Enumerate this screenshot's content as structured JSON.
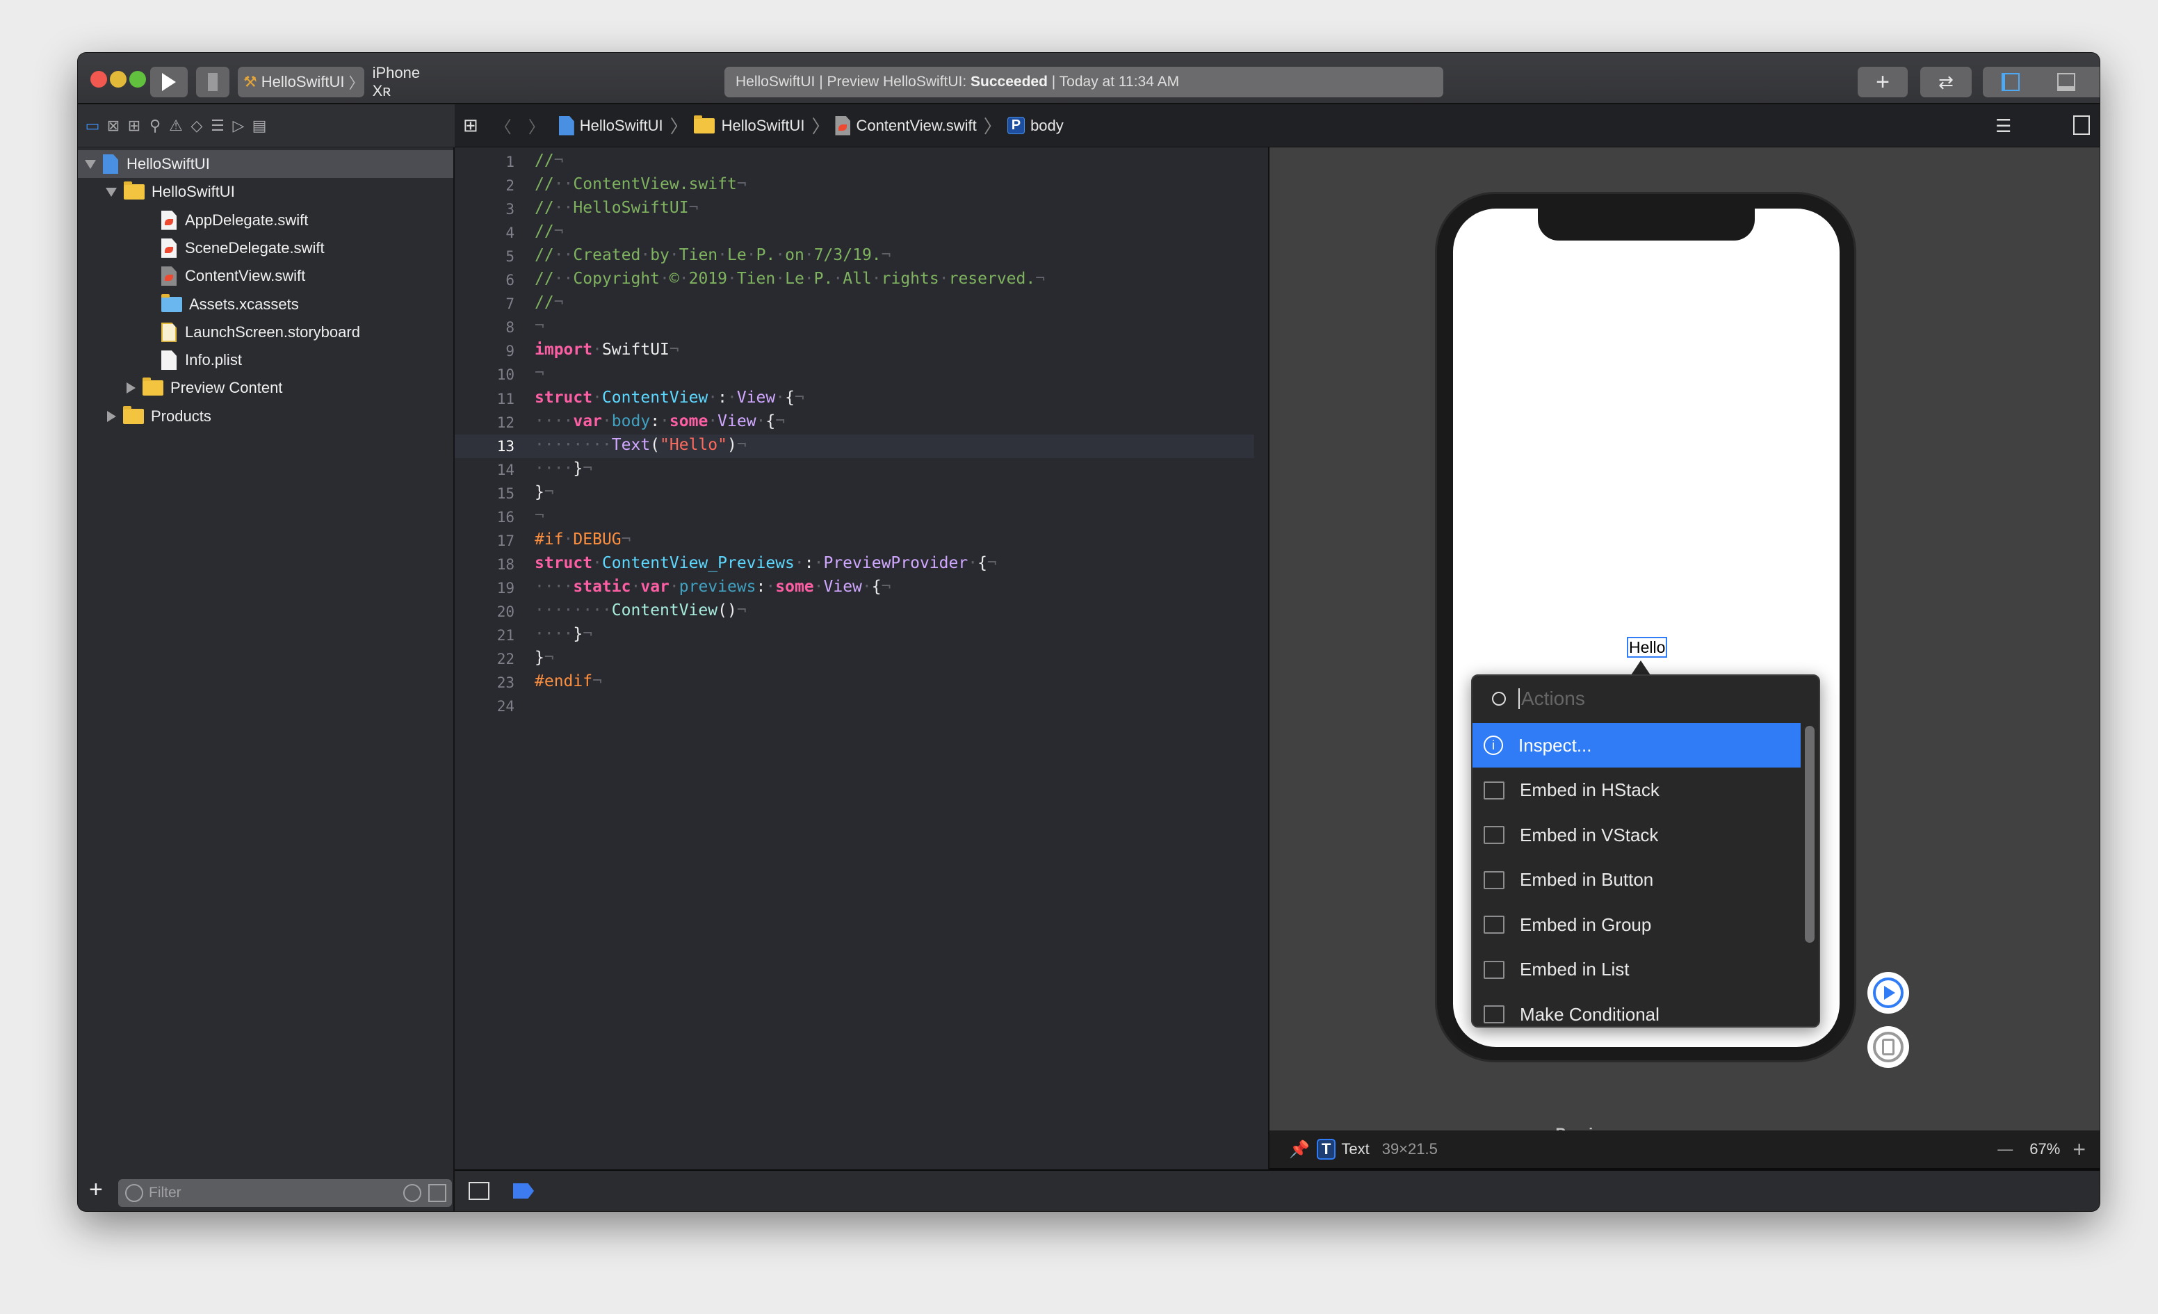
{
  "toolbar": {
    "scheme": "HelloSwiftUI",
    "device": "iPhone Xʀ",
    "status_prefix": "HelloSwiftUI | Preview HelloSwiftUI: ",
    "status_result": "Succeeded",
    "status_suffix": " | Today at 11:34 AM",
    "add_label": "+",
    "colors": {
      "close": "#f1584f",
      "minimize": "#e3b93a",
      "zoom": "#62c03f",
      "accent": "#2f7cf6"
    }
  },
  "jumpbar": {
    "crumbs": [
      "HelloSwiftUI",
      "HelloSwiftUI",
      "ContentView.swift",
      "body"
    ],
    "property_badge": "P"
  },
  "sidebar": {
    "items": [
      {
        "label": "HelloSwiftUI",
        "kind": "project",
        "expanded": true,
        "selected": true
      },
      {
        "label": "HelloSwiftUI",
        "kind": "folder",
        "expanded": true
      },
      {
        "label": "AppDelegate.swift",
        "kind": "swift"
      },
      {
        "label": "SceneDelegate.swift",
        "kind": "swift"
      },
      {
        "label": "ContentView.swift",
        "kind": "swift-dim"
      },
      {
        "label": "Assets.xcassets",
        "kind": "assets"
      },
      {
        "label": "LaunchScreen.storyboard",
        "kind": "storyboard"
      },
      {
        "label": "Info.plist",
        "kind": "plist"
      },
      {
        "label": "Preview Content",
        "kind": "folder",
        "expanded": false
      },
      {
        "label": "Products",
        "kind": "folder",
        "expanded": false
      }
    ],
    "filter_placeholder": "Filter"
  },
  "editor": {
    "current_line": 13,
    "lines": [
      [
        [
          "//",
          "com"
        ],
        [
          "¬",
          "ws"
        ]
      ],
      [
        [
          "//",
          "com"
        ],
        [
          "··",
          "ws"
        ],
        [
          "ContentView.swift",
          "com"
        ],
        [
          "¬",
          "ws"
        ]
      ],
      [
        [
          "//",
          "com"
        ],
        [
          "··",
          "ws"
        ],
        [
          "HelloSwiftUI",
          "com"
        ],
        [
          "¬",
          "ws"
        ]
      ],
      [
        [
          "//",
          "com"
        ],
        [
          "¬",
          "ws"
        ]
      ],
      [
        [
          "//",
          "com"
        ],
        [
          "··",
          "ws"
        ],
        [
          "Created",
          "com"
        ],
        [
          "·",
          "ws"
        ],
        [
          "by",
          "com"
        ],
        [
          "·",
          "ws"
        ],
        [
          "Tien",
          "com"
        ],
        [
          "·",
          "ws"
        ],
        [
          "Le",
          "com"
        ],
        [
          "·",
          "ws"
        ],
        [
          "P.",
          "com"
        ],
        [
          "·",
          "ws"
        ],
        [
          "on",
          "com"
        ],
        [
          "·",
          "ws"
        ],
        [
          "7/3/19.",
          "com"
        ],
        [
          "¬",
          "ws"
        ]
      ],
      [
        [
          "//",
          "com"
        ],
        [
          "··",
          "ws"
        ],
        [
          "Copyright",
          "com"
        ],
        [
          "·",
          "ws"
        ],
        [
          "©",
          "com"
        ],
        [
          "·",
          "ws"
        ],
        [
          "2019",
          "com"
        ],
        [
          "·",
          "ws"
        ],
        [
          "Tien",
          "com"
        ],
        [
          "·",
          "ws"
        ],
        [
          "Le",
          "com"
        ],
        [
          "·",
          "ws"
        ],
        [
          "P.",
          "com"
        ],
        [
          "·",
          "ws"
        ],
        [
          "All",
          "com"
        ],
        [
          "·",
          "ws"
        ],
        [
          "rights",
          "com"
        ],
        [
          "·",
          "ws"
        ],
        [
          "reserved.",
          "com"
        ],
        [
          "¬",
          "ws"
        ]
      ],
      [
        [
          "//",
          "com"
        ],
        [
          "¬",
          "ws"
        ]
      ],
      [
        [
          "¬",
          "ws"
        ]
      ],
      [
        [
          "import",
          "kw"
        ],
        [
          "·",
          "ws"
        ],
        [
          "SwiftUI",
          "pl"
        ],
        [
          "¬",
          "ws"
        ]
      ],
      [
        [
          "¬",
          "ws"
        ]
      ],
      [
        [
          "struct",
          "kw"
        ],
        [
          "·",
          "ws"
        ],
        [
          "ContentView",
          "decl"
        ],
        [
          "·",
          "ws"
        ],
        [
          ":",
          "pl"
        ],
        [
          "·",
          "ws"
        ],
        [
          "View",
          "type"
        ],
        [
          "·",
          "ws"
        ],
        [
          "{",
          "pl"
        ],
        [
          "¬",
          "ws"
        ]
      ],
      [
        [
          "····",
          "ws"
        ],
        [
          "var",
          "kw"
        ],
        [
          "·",
          "ws"
        ],
        [
          "body",
          "prop"
        ],
        [
          ":",
          "pl"
        ],
        [
          "·",
          "ws"
        ],
        [
          "some",
          "kw"
        ],
        [
          "·",
          "ws"
        ],
        [
          "View",
          "type"
        ],
        [
          "·",
          "ws"
        ],
        [
          "{",
          "pl"
        ],
        [
          "¬",
          "ws"
        ]
      ],
      [
        [
          "········",
          "ws"
        ],
        [
          "Text",
          "type"
        ],
        [
          "(",
          "pl"
        ],
        [
          "\"Hello\"",
          "str"
        ],
        [
          ")",
          "pl"
        ],
        [
          "¬",
          "ws"
        ]
      ],
      [
        [
          "····",
          "ws"
        ],
        [
          "}",
          "pl"
        ],
        [
          "¬",
          "ws"
        ]
      ],
      [
        [
          "}",
          "pl"
        ],
        [
          "¬",
          "ws"
        ]
      ],
      [
        [
          "¬",
          "ws"
        ]
      ],
      [
        [
          "#if",
          "pre"
        ],
        [
          "·",
          "ws"
        ],
        [
          "DEBUG",
          "pre"
        ],
        [
          "¬",
          "ws"
        ]
      ],
      [
        [
          "struct",
          "kw"
        ],
        [
          "·",
          "ws"
        ],
        [
          "ContentView_Previews",
          "decl"
        ],
        [
          "·",
          "ws"
        ],
        [
          ":",
          "pl"
        ],
        [
          "·",
          "ws"
        ],
        [
          "PreviewProvider",
          "type"
        ],
        [
          "·",
          "ws"
        ],
        [
          "{",
          "pl"
        ],
        [
          "¬",
          "ws"
        ]
      ],
      [
        [
          "····",
          "ws"
        ],
        [
          "static",
          "kw"
        ],
        [
          "·",
          "ws"
        ],
        [
          "var",
          "kw"
        ],
        [
          "·",
          "ws"
        ],
        [
          "previews",
          "prop"
        ],
        [
          ":",
          "pl"
        ],
        [
          "·",
          "ws"
        ],
        [
          "some",
          "kw"
        ],
        [
          "·",
          "ws"
        ],
        [
          "View",
          "type"
        ],
        [
          "·",
          "ws"
        ],
        [
          "{",
          "pl"
        ],
        [
          "¬",
          "ws"
        ]
      ],
      [
        [
          "········",
          "ws"
        ],
        [
          "ContentView",
          "fn"
        ],
        [
          "()",
          "pl"
        ],
        [
          "¬",
          "ws"
        ]
      ],
      [
        [
          "····",
          "ws"
        ],
        [
          "}",
          "pl"
        ],
        [
          "¬",
          "ws"
        ]
      ],
      [
        [
          "}",
          "pl"
        ],
        [
          "¬",
          "ws"
        ]
      ],
      [
        [
          "#endif",
          "pre"
        ],
        [
          "¬",
          "ws"
        ]
      ],
      []
    ]
  },
  "preview": {
    "hello_text": "Hello",
    "label": "Preview",
    "search_placeholder": "Actions",
    "actions": [
      {
        "label": "Inspect...",
        "icon": "info-icon",
        "selected": true
      },
      {
        "label": "Embed in HStack",
        "icon": "hstack-icon"
      },
      {
        "label": "Embed in VStack",
        "icon": "vstack-icon"
      },
      {
        "label": "Embed in Button",
        "icon": "button-icon"
      },
      {
        "label": "Embed in Group",
        "icon": "group-icon"
      },
      {
        "label": "Embed in List",
        "icon": "list-icon"
      },
      {
        "label": "Make Conditional",
        "icon": "conditional-icon"
      }
    ],
    "bottom": {
      "badge": "T",
      "element": "Text",
      "size": "39×21.5",
      "zoom": "67%",
      "minus": "—",
      "plus": "+"
    }
  }
}
